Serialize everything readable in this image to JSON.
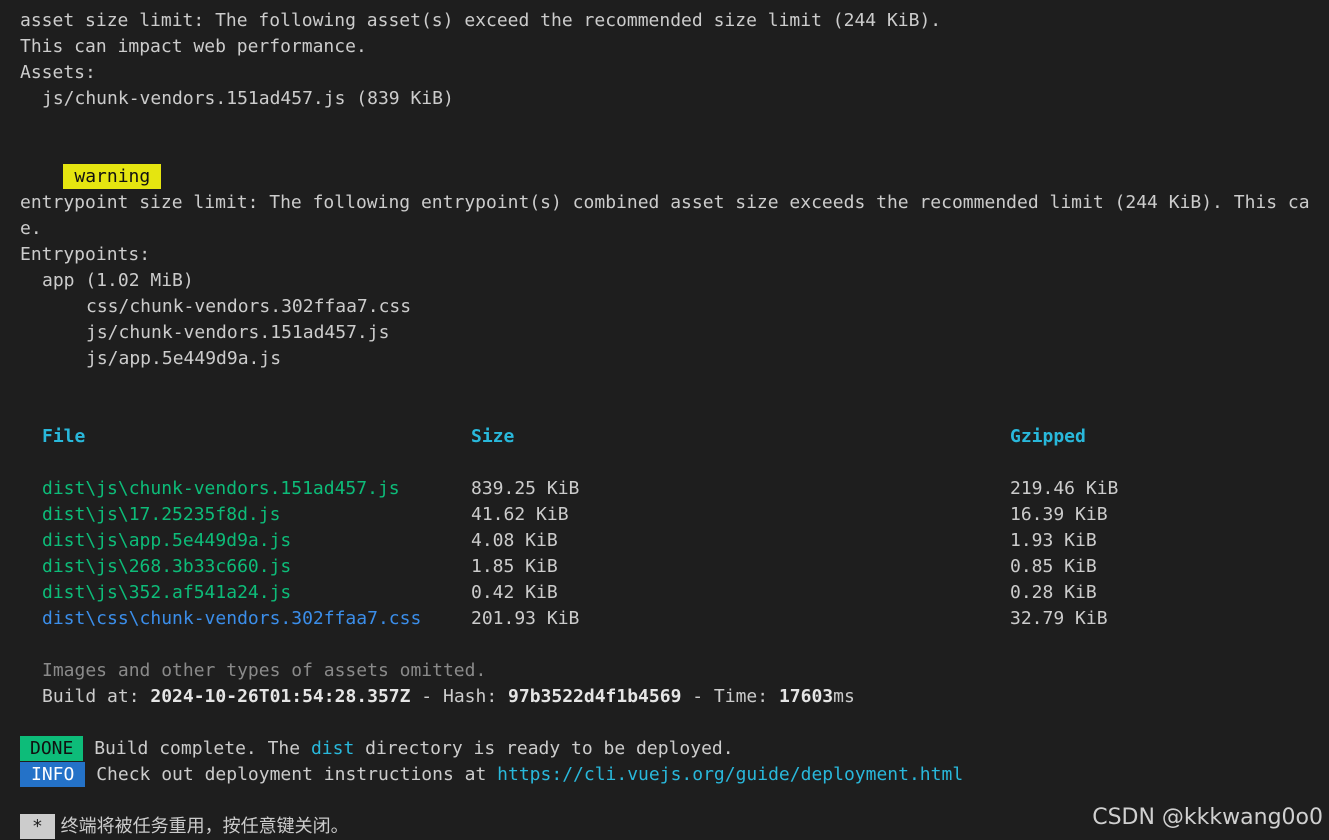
{
  "asset_warning": {
    "line1": "asset size limit: The following asset(s) exceed the recommended size limit (244 KiB).",
    "line2": "This can impact web performance.",
    "assets_label": "Assets:",
    "asset_item": "js/chunk-vendors.151ad457.js (839 KiB)"
  },
  "warning_badge": "warning",
  "entrypoint_warning": {
    "line1": "entrypoint size limit: The following entrypoint(s) combined asset size exceeds the recommended limit (244 KiB). This ca",
    "line2": "e.",
    "entrypoints_label": "Entrypoints:",
    "app_label": "app (1.02 MiB)",
    "files": [
      "css/chunk-vendors.302ffaa7.css",
      "js/chunk-vendors.151ad457.js",
      "js/app.5e449d9a.js"
    ]
  },
  "table": {
    "headers": {
      "file": "File",
      "size": "Size",
      "gzipped": "Gzipped"
    },
    "rows": [
      {
        "file": "dist\\js\\chunk-vendors.151ad457.js",
        "size": "839.25 KiB",
        "gzipped": "219.46 KiB",
        "kind": "js"
      },
      {
        "file": "dist\\js\\17.25235f8d.js",
        "size": "41.62 KiB",
        "gzipped": "16.39 KiB",
        "kind": "js"
      },
      {
        "file": "dist\\js\\app.5e449d9a.js",
        "size": "4.08 KiB",
        "gzipped": "1.93 KiB",
        "kind": "js"
      },
      {
        "file": "dist\\js\\268.3b33c660.js",
        "size": "1.85 KiB",
        "gzipped": "0.85 KiB",
        "kind": "js"
      },
      {
        "file": "dist\\js\\352.af541a24.js",
        "size": "0.42 KiB",
        "gzipped": "0.28 KiB",
        "kind": "js"
      },
      {
        "file": "dist\\css\\chunk-vendors.302ffaa7.css",
        "size": "201.93 KiB",
        "gzipped": "32.79 KiB",
        "kind": "css"
      }
    ]
  },
  "omitted_note": "Images and other types of assets omitted.",
  "build_info": {
    "build_at_label": "Build at: ",
    "build_at_value": "2024-10-26T01:54:28.357Z",
    "hash_label": " - Hash: ",
    "hash_value": "97b3522d4f1b4569",
    "time_label": " - Time: ",
    "time_value": "17603",
    "time_unit": "ms"
  },
  "done": {
    "badge": "DONE",
    "text_before": " Build complete. The ",
    "dir": "dist",
    "text_after": " directory is ready to be deployed."
  },
  "info": {
    "badge": "INFO",
    "text": " Check out deployment instructions at ",
    "url": "https://cli.vuejs.org/guide/deployment.html"
  },
  "footer": {
    "star_badge": "*",
    "message": " 终端将被任务重用，按任意键关闭。"
  },
  "watermark": "CSDN @kkkwang0o0",
  "colors": {
    "background": "#1e1e1e",
    "warning_badge": "#e5e510",
    "done_badge": "#0dbc79",
    "info_badge": "#2472c8",
    "header_cyan": "#29b8db",
    "file_green": "#0dbc79",
    "file_blue": "#3b8eea"
  }
}
